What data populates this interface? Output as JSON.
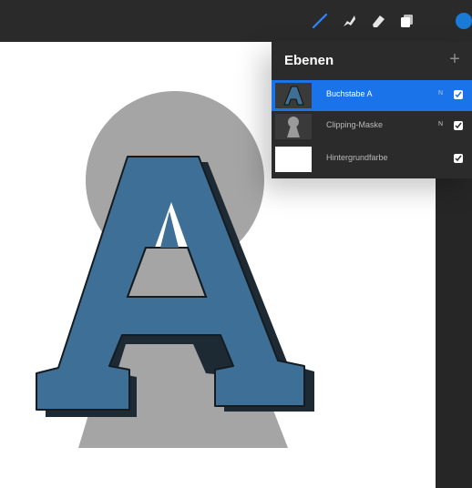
{
  "toolbar": {
    "tools": [
      "brush-icon",
      "smudge-icon",
      "eraser-icon",
      "layers-icon",
      "color-picker-icon"
    ],
    "accent_color": "#1a73e8",
    "current_color": "#1a7bd6"
  },
  "layers_panel": {
    "title": "Ebenen",
    "add_label": "+",
    "layers": [
      {
        "name": "Buchstabe A",
        "blend": "N",
        "visible": true,
        "selected": true
      },
      {
        "name": "Clipping-Maske",
        "blend": "N",
        "visible": true,
        "selected": false
      },
      {
        "name": "Hintergrundfarbe",
        "blend": "",
        "visible": true,
        "selected": false
      }
    ]
  },
  "artwork": {
    "letter": "A",
    "letter_color": "#3e6f96",
    "shadow_color": "#1d2a33",
    "keyhole_color": "#a5a5a5"
  }
}
